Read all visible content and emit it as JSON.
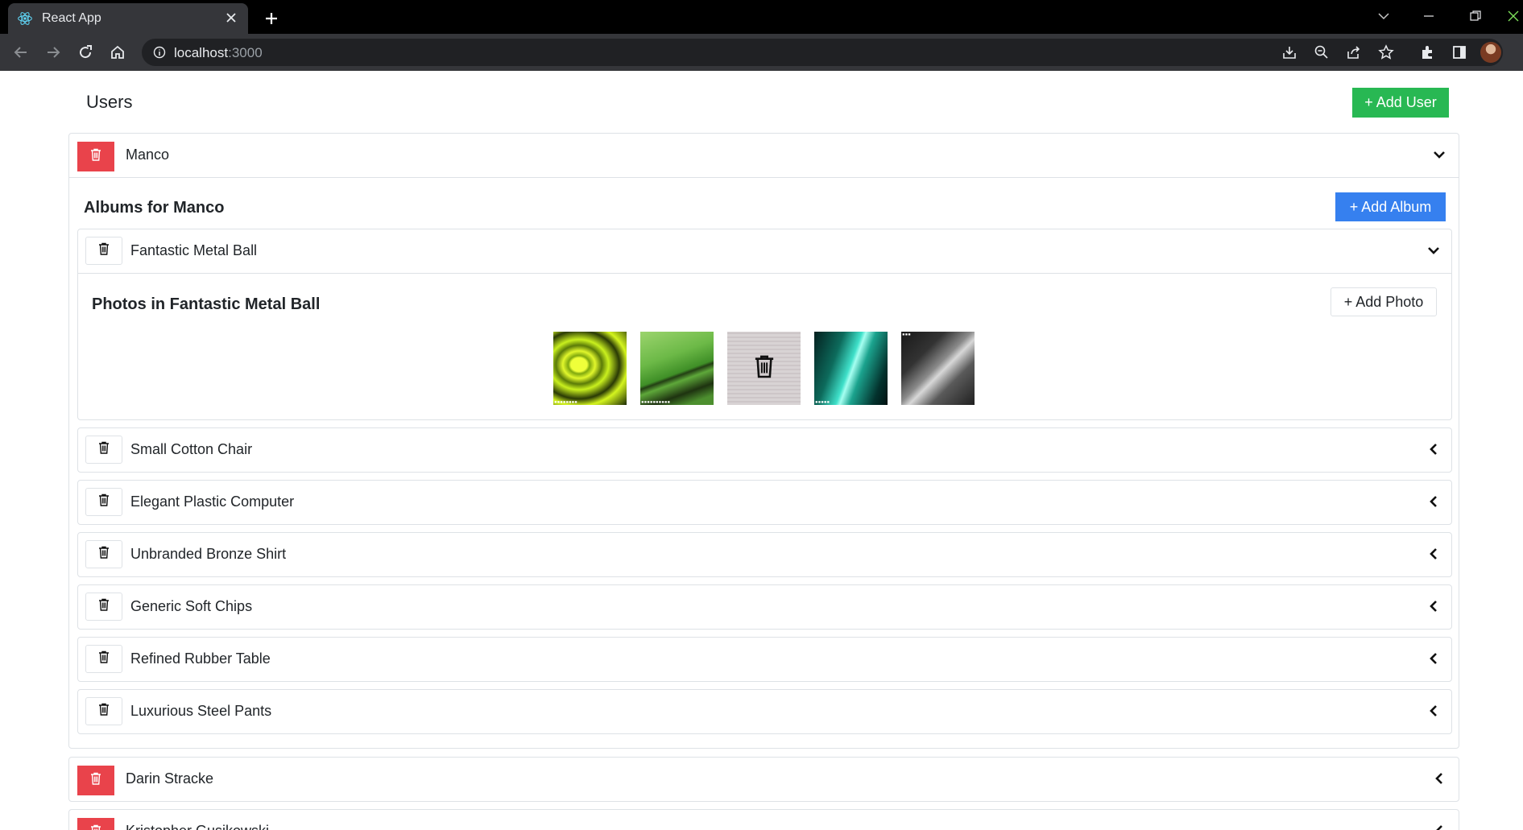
{
  "browser": {
    "tab_title": "React App",
    "url_host": "localhost",
    "url_port": ":3000"
  },
  "page": {
    "title": "Users",
    "add_user_label": "+ Add User"
  },
  "users": [
    {
      "name": "Manco",
      "expanded": true,
      "albums_title": "Albums for Manco",
      "add_album_label": "+ Add Album",
      "albums": [
        {
          "name": "Fantastic Metal Ball",
          "expanded": true,
          "photos_title": "Photos in Fantastic Metal Ball",
          "add_photo_label": "+ Add Photo",
          "photos": [
            "photo-1",
            "photo-2",
            "photo-3",
            "photo-4",
            "photo-5"
          ]
        },
        {
          "name": "Small Cotton Chair"
        },
        {
          "name": "Elegant Plastic Computer"
        },
        {
          "name": "Unbranded Bronze Shirt"
        },
        {
          "name": "Generic Soft Chips"
        },
        {
          "name": "Refined Rubber Table"
        },
        {
          "name": "Luxurious Steel Pants"
        }
      ]
    },
    {
      "name": "Darin Stracke",
      "expanded": false
    },
    {
      "name": "Kristopher Gusikowski",
      "expanded": false
    }
  ],
  "colors": {
    "success": "#28b853",
    "primary": "#3680ef",
    "danger": "#e9434b"
  }
}
